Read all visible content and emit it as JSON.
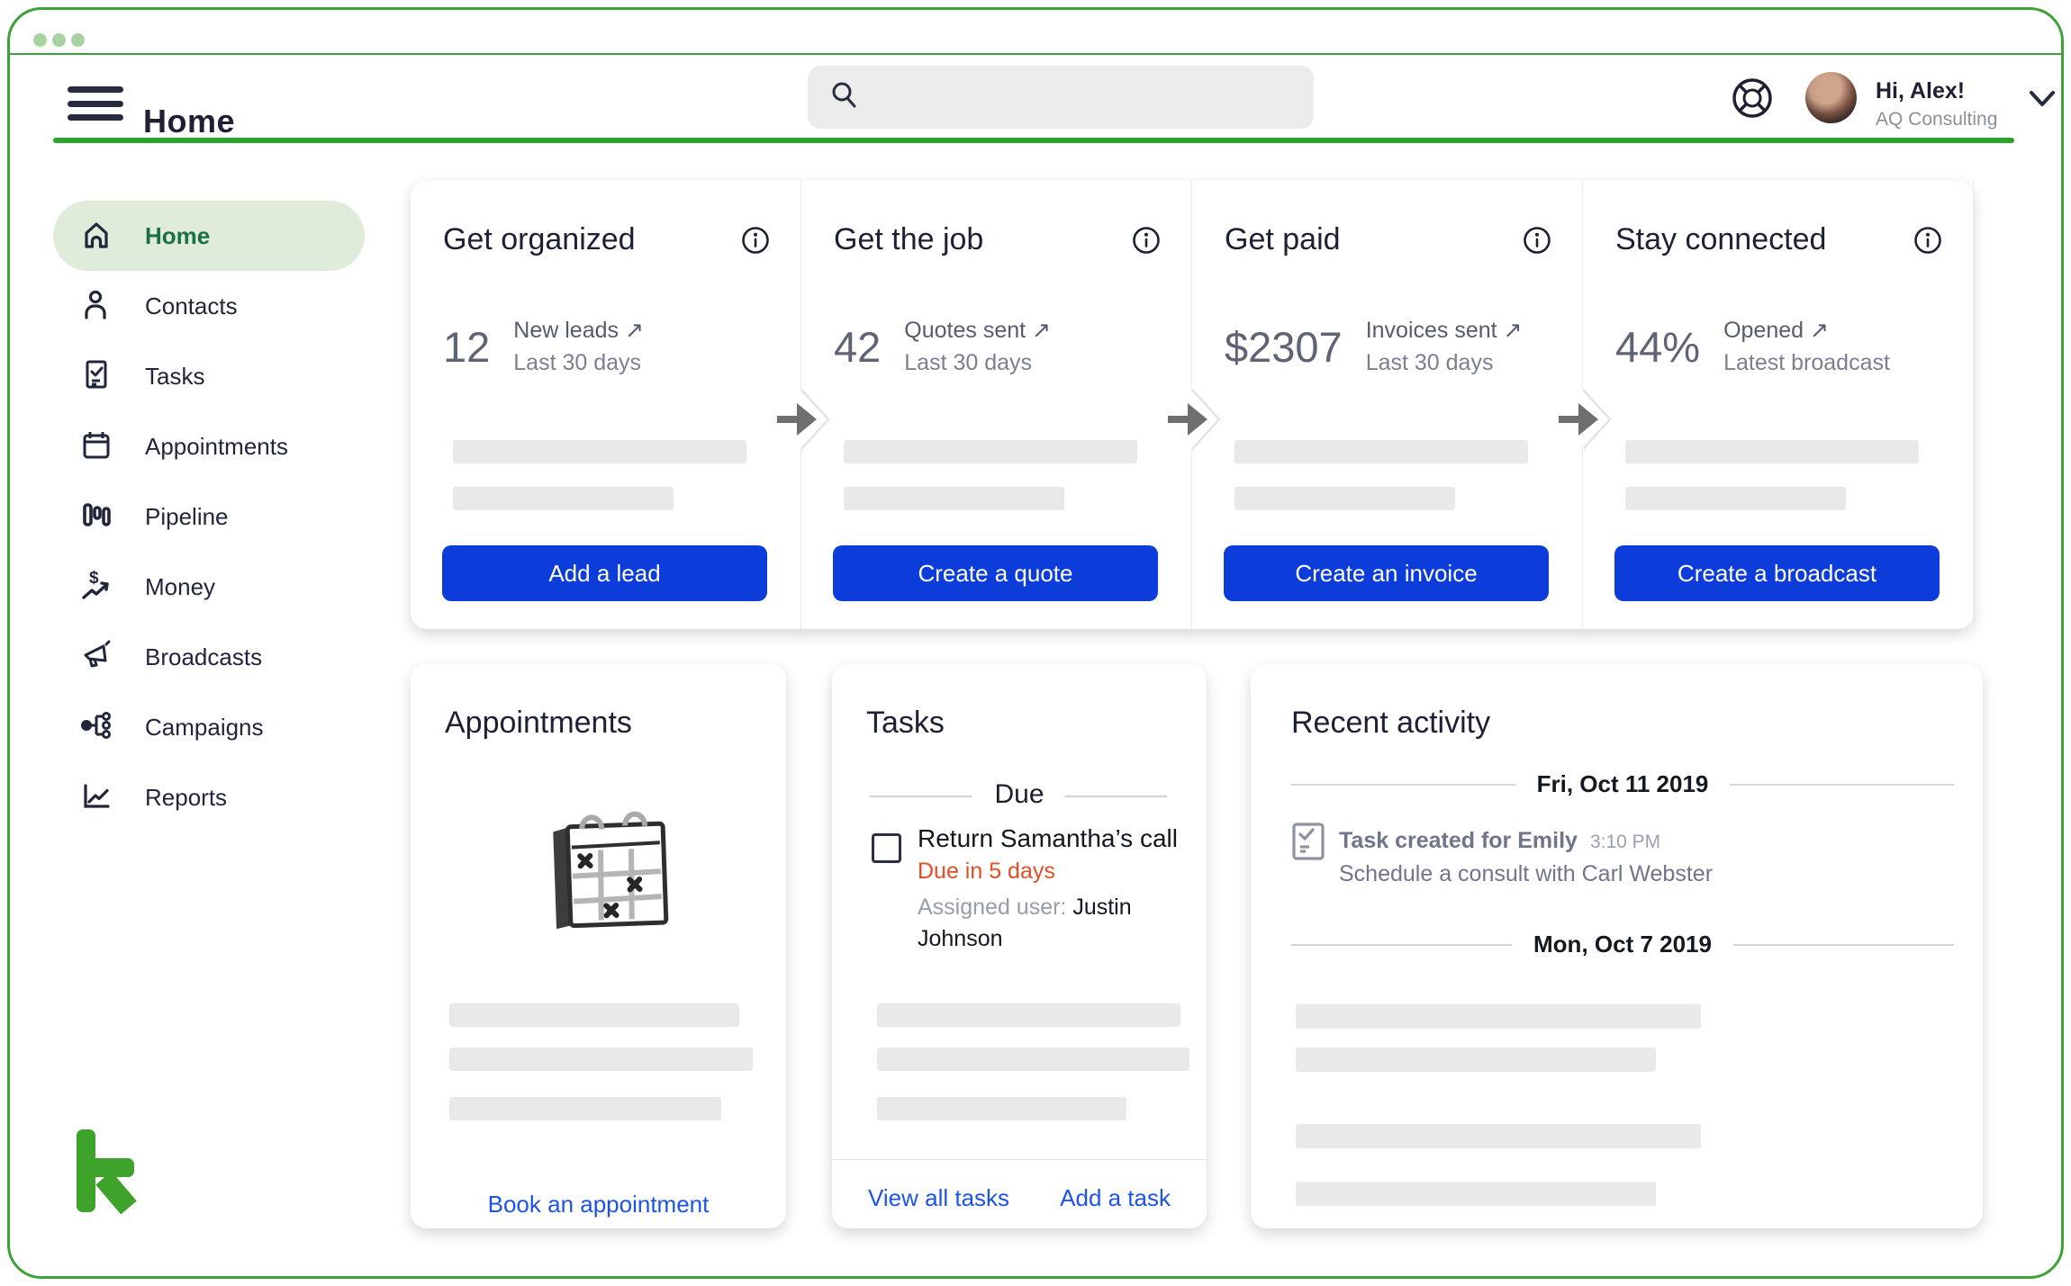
{
  "header": {
    "title": "Home",
    "search_placeholder": "",
    "user": {
      "greeting": "Hi, Alex!",
      "company": "AQ Consulting"
    }
  },
  "sidebar": {
    "items": [
      {
        "label": "Home",
        "icon": "home-icon",
        "active": true
      },
      {
        "label": "Contacts",
        "icon": "contacts-icon",
        "active": false
      },
      {
        "label": "Tasks",
        "icon": "tasks-icon",
        "active": false
      },
      {
        "label": "Appointments",
        "icon": "calendar-icon",
        "active": false
      },
      {
        "label": "Pipeline",
        "icon": "pipeline-icon",
        "active": false
      },
      {
        "label": "Money",
        "icon": "money-icon",
        "active": false
      },
      {
        "label": "Broadcasts",
        "icon": "megaphone-icon",
        "active": false
      },
      {
        "label": "Campaigns",
        "icon": "campaigns-icon",
        "active": false
      },
      {
        "label": "Reports",
        "icon": "reports-icon",
        "active": false
      }
    ]
  },
  "pipeline_cards": {
    "items": [
      {
        "title": "Get organized",
        "stat": "12",
        "label": "New leads ↗",
        "sublabel": "Last 30 days",
        "button": "Add a lead"
      },
      {
        "title": "Get the job",
        "stat": "42",
        "label": "Quotes sent ↗",
        "sublabel": "Last 30 days",
        "button": "Create a quote"
      },
      {
        "title": "Get paid",
        "stat": "$2307",
        "label": "Invoices sent ↗",
        "sublabel": "Last 30 days",
        "button": "Create an invoice"
      },
      {
        "title": "Stay connected",
        "stat": "44%",
        "label": "Opened ↗",
        "sublabel": "Latest broadcast",
        "button": "Create a broadcast"
      }
    ]
  },
  "appointments": {
    "title": "Appointments",
    "link": "Book an appointment"
  },
  "tasks": {
    "title": "Tasks",
    "section": "Due",
    "item": {
      "title": "Return Samantha’s call",
      "due": "Due in 5 days",
      "assigned_label": "Assigned user: ",
      "assigned_user": "Justin Johnson"
    },
    "view_all": "View all tasks",
    "add": "Add a task"
  },
  "recent_activity": {
    "title": "Recent activity",
    "groups": [
      {
        "date": "Fri, Oct 11 2019",
        "item": {
          "title": "Task created for Emily",
          "time": "3:10 PM",
          "description": "Schedule a consult with Carl Webster"
        }
      },
      {
        "date": "Mon, Oct 7 2019"
      }
    ]
  },
  "colors": {
    "accent_green": "#3da336",
    "rule_green": "#2ba32a",
    "pale_green": "#dfecda",
    "active_green": "#1c6f46",
    "brand_blue": "#0c3ddb",
    "link_blue": "#1d53ea",
    "alert_orange": "#e64d24"
  }
}
